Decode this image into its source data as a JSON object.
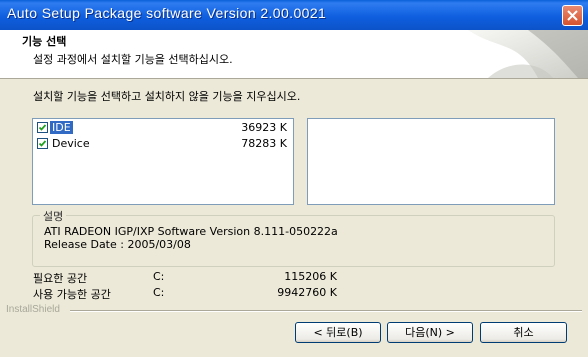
{
  "window": {
    "title": "Auto Setup Package software Version 2.00.0021"
  },
  "header": {
    "title": "기능 선택",
    "subtitle": "설정 과정에서 설치할 기능을 선택하십시오."
  },
  "instruction": "설치할 기능을 선택하고 설치하지 않을 기능을 지우십시오.",
  "features": [
    {
      "name": "IDE",
      "size": "36923 K",
      "checked": true,
      "selected": true
    },
    {
      "name": "Device",
      "size": "78283 K",
      "checked": true,
      "selected": false
    }
  ],
  "description": {
    "legend": "설명",
    "line1": "ATI RADEON IGP/IXP Software Version 8.111-050222a",
    "line2": "Release Date : 2005/03/08"
  },
  "space": {
    "required": {
      "label": "필요한 공간",
      "drive": "C:",
      "value": "115206 K"
    },
    "available": {
      "label": "사용 가능한 공간",
      "drive": "C:",
      "value": "9942760 K"
    }
  },
  "brand": "InstallShield",
  "buttons": {
    "back": "< 뒤로(B)",
    "next": "다음(N) >",
    "cancel": "취소"
  },
  "colors": {
    "titlebar": "#0c53c8",
    "selection": "#316ac5",
    "window_bg": "#ece9d8"
  },
  "icons": {
    "close": "close-icon",
    "checkbox": "checkmark-icon"
  }
}
